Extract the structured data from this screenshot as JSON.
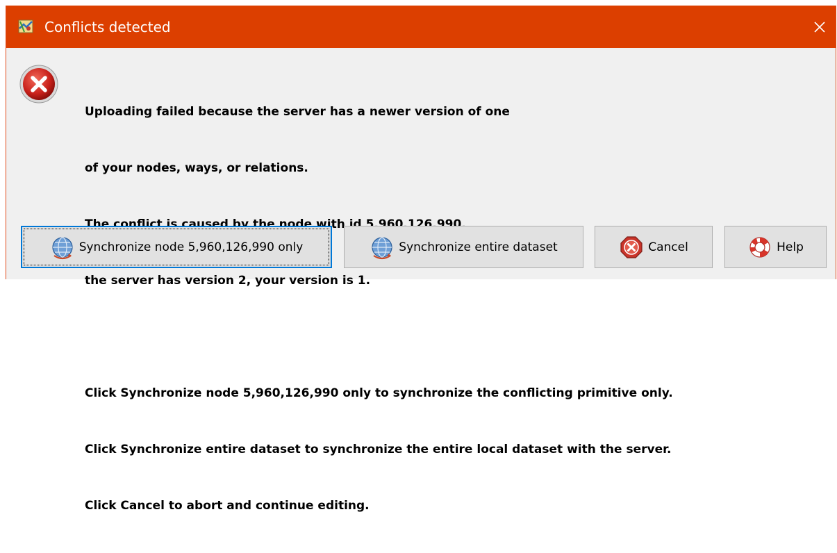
{
  "window": {
    "title": "Conflicts detected",
    "titlebar_color": "#dc3f00"
  },
  "icons": {
    "app": "josm-map-icon",
    "close": "close-icon",
    "message": "error-icon"
  },
  "message": {
    "lines": [
      "Uploading failed because the server has a newer version of one",
      "of your nodes, ways, or relations.",
      "The conflict is caused by the node with id 5,960,126,990,",
      "the server has version 2, your version is 1.",
      "",
      "Click Synchronize node 5,960,126,990 only to synchronize the conflicting primitive only.",
      "Click Synchronize entire dataset to synchronize the entire local dataset with the server.",
      "Click Cancel to abort and continue editing."
    ]
  },
  "buttons": {
    "sync_node": {
      "label": "Synchronize node 5,960,126,990 only",
      "icon": "globe-sync-icon"
    },
    "sync_dataset": {
      "label": "Synchronize entire dataset",
      "icon": "globe-sync-icon"
    },
    "cancel": {
      "label": "Cancel",
      "icon": "cancel-icon"
    },
    "help": {
      "label": "Help",
      "icon": "lifebuoy-icon"
    }
  }
}
